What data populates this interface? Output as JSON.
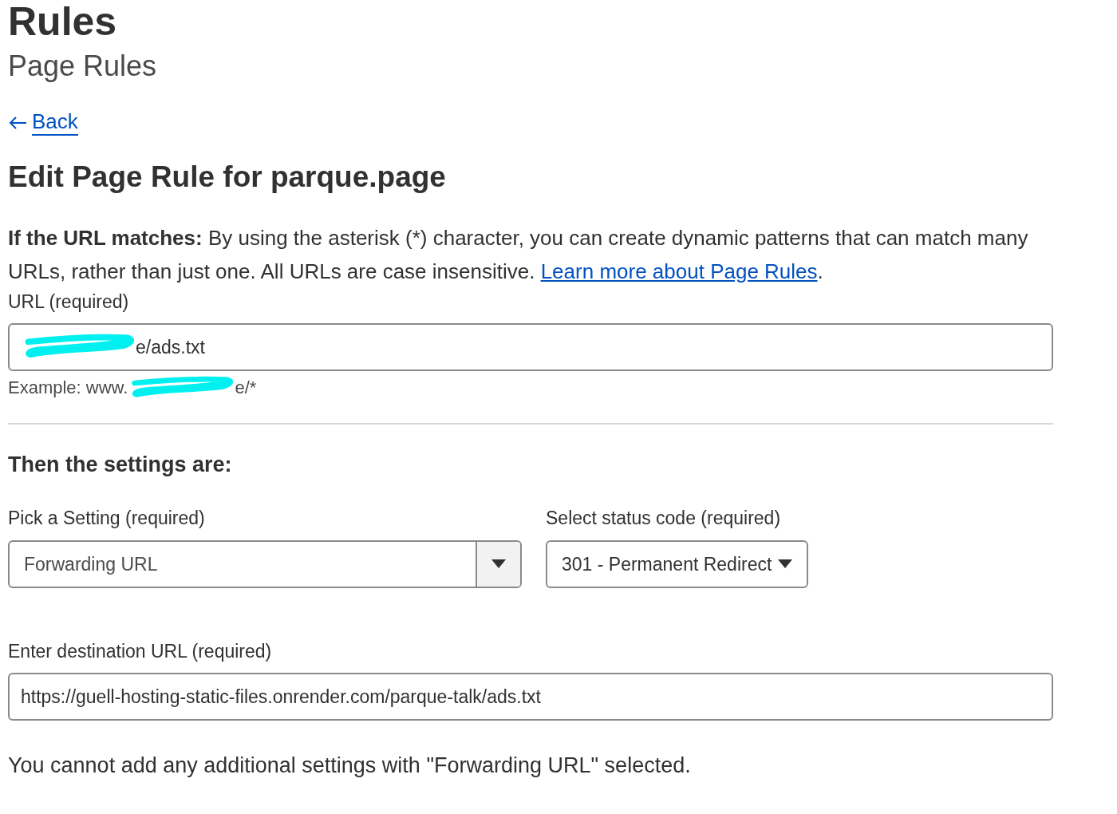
{
  "header": {
    "title": "Rules",
    "subtitle": "Page Rules"
  },
  "back_link": {
    "label": "Back"
  },
  "heading": "Edit Page Rule for parque.page",
  "intro": {
    "text": "**If the URL matches:** By using the asterisk (*) character, you can create dynamic patterns that can match many URLs, rather than just one. All URLs are case insensitive. ",
    "link": "Learn more about Page Rules",
    "after": "."
  },
  "url_field": {
    "label": "URL (required)",
    "value_end": "e/ads.txt",
    "redacted": true
  },
  "url_example": {
    "text_start": "Example: www.",
    "text_end": "e/*",
    "redacted": true
  },
  "settings_heading": "Then the settings are:",
  "setting_select": {
    "label": "Pick a Setting (required)",
    "value": "Forwarding URL"
  },
  "status_select": {
    "label": "Select status code (required)",
    "value": "301 - Permanent Redirect"
  },
  "destination_field": {
    "label": "Enter destination URL (required)",
    "value": "https://guell-hosting-static-files.onrender.com/parque-talk/ads.txt"
  },
  "note": "You cannot add any additional settings with \"Forwarding URL\" selected."
}
